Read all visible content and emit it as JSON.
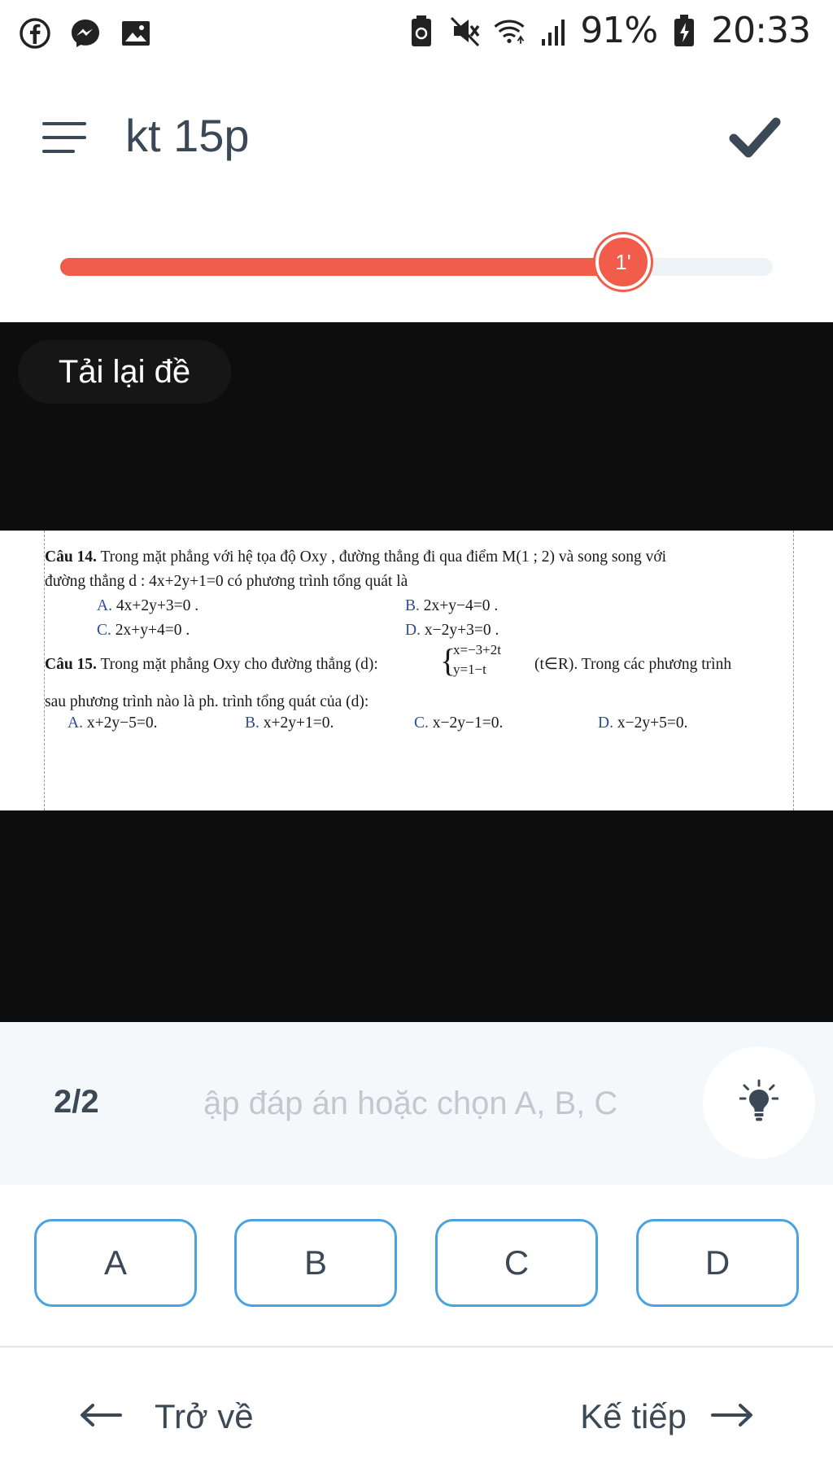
{
  "status_bar": {
    "left_icons": [
      "facebook-icon",
      "messenger-icon",
      "gallery-icon"
    ],
    "right_icons": [
      "saver-icon",
      "mute-icon",
      "wifi-icon",
      "signal-icon",
      "battery-charging-icon"
    ],
    "battery": "91%",
    "time": "20:33"
  },
  "header": {
    "title": "kt 15p",
    "menu_icon": "hamburger-icon",
    "submit_icon": "check-icon"
  },
  "progress": {
    "fraction": 0.79,
    "knob_label": "1'",
    "fill_color": "#f25c4a",
    "track_color": "#eef3f7"
  },
  "viewer": {
    "reload_label": "Tải lại đề",
    "questions": [
      {
        "number": "Câu 14.",
        "line1_text": " Trong mặt phẳng với hệ tọa độ Oxy , đường thẳng đi qua điểm M(1 ; 2) và song song với",
        "line2_text": "đường thẳng d : 4x+2y+1=0 có phương trình tổng quát là",
        "options": [
          {
            "letter": "A.",
            "text": " 4x+2y+3=0 ."
          },
          {
            "letter": "B.",
            "text": " 2x+y−4=0 ."
          },
          {
            "letter": "C.",
            "text": " 2x+y+4=0 ."
          },
          {
            "letter": "D.",
            "text": " x−2y+3=0 ."
          }
        ]
      },
      {
        "number": "Câu 15.",
        "line1_prefix": " Trong mặt phẳng Oxy cho đường thẳng (d):",
        "system_line1": "x=−3+2t",
        "system_line2": "y=1−t",
        "line1_suffix": "(t∈R). Trong các phương trình",
        "line2_text": "sau phương trình nào là ph. trình tổng quát của (d):",
        "options": [
          {
            "letter": "A.",
            "text": " x+2y−5=0."
          },
          {
            "letter": "B.",
            "text": "  x+2y+1=0."
          },
          {
            "letter": "C.",
            "text": " x−2y−1=0."
          },
          {
            "letter": "D.",
            "text": "   x−2y+5=0."
          }
        ]
      }
    ]
  },
  "answer_bar": {
    "page": "2/2",
    "placeholder": "ập đáp án hoặc chọn A, B, C",
    "hint_icon": "lightbulb-icon"
  },
  "choices": [
    "A",
    "B",
    "C",
    "D"
  ],
  "nav": {
    "back_label": "Trở về",
    "next_label": "Kế tiếp"
  },
  "colors": {
    "accent": "#f25c4a",
    "choice_border": "#4aa3df",
    "text": "#3b4856"
  }
}
